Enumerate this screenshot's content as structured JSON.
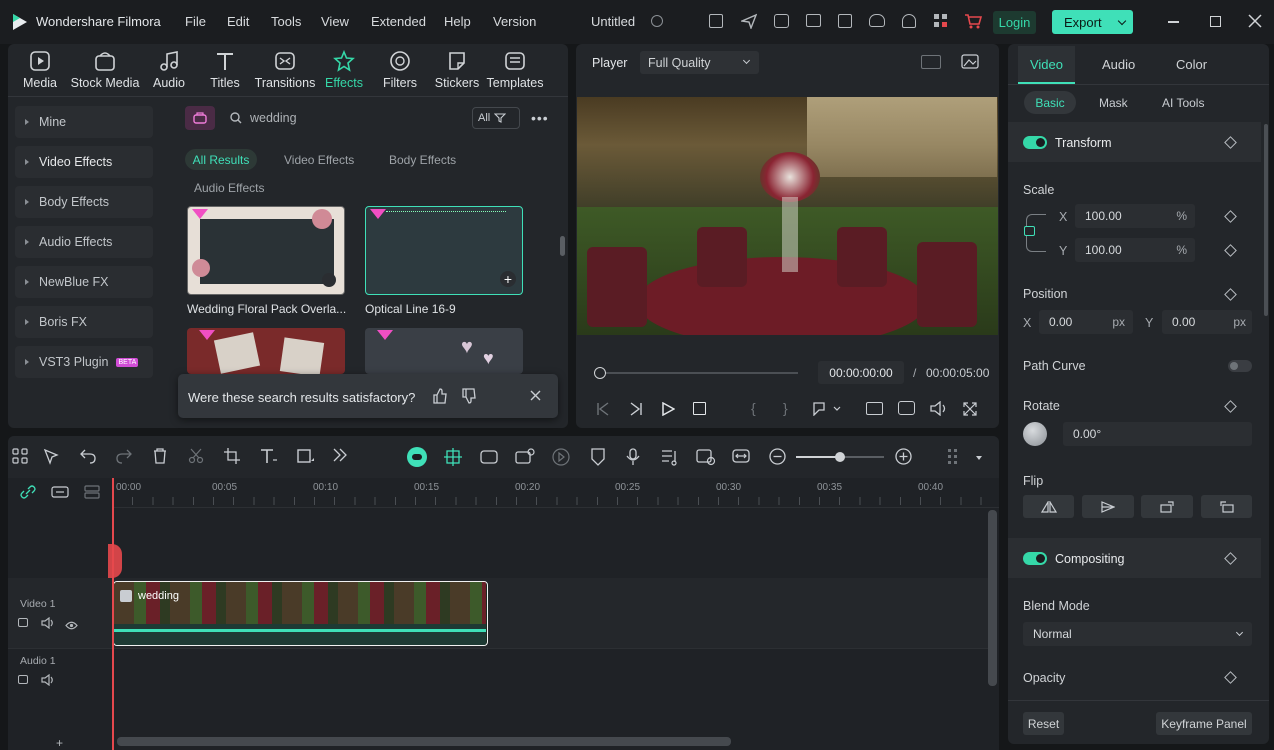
{
  "app": {
    "name": "Wondershare Filmora",
    "project_title": "Untitled"
  },
  "menu": [
    "File",
    "Edit",
    "Tools",
    "View",
    "Extended",
    "Help",
    "Version"
  ],
  "header_buttons": {
    "login": "Login",
    "export": "Export"
  },
  "toolbar": [
    {
      "label": "Media",
      "icon": "media-icon"
    },
    {
      "label": "Stock Media",
      "icon": "stock-media-icon"
    },
    {
      "label": "Audio",
      "icon": "audio-icon"
    },
    {
      "label": "Titles",
      "icon": "titles-icon"
    },
    {
      "label": "Transitions",
      "icon": "transitions-icon"
    },
    {
      "label": "Effects",
      "icon": "effects-icon"
    },
    {
      "label": "Filters",
      "icon": "filters-icon"
    },
    {
      "label": "Stickers",
      "icon": "stickers-icon"
    },
    {
      "label": "Templates",
      "icon": "templates-icon"
    }
  ],
  "categories": [
    "Mine",
    "Video Effects",
    "Body Effects",
    "Audio Effects",
    "NewBlue FX",
    "Boris FX",
    "VST3 Plugin"
  ],
  "beta_badge": "BETA",
  "search": {
    "value": "wedding",
    "filter": "All"
  },
  "result_tabs": [
    "All Results",
    "Video Effects",
    "Body Effects",
    "Audio Effects"
  ],
  "results": [
    {
      "name": "Wedding Floral Pack Overla..."
    },
    {
      "name": "Optical Line 16-9"
    }
  ],
  "feedback": {
    "question": "Were these search results satisfactory?"
  },
  "player": {
    "label": "Player",
    "quality": "Full Quality",
    "current_time": "00:00:00:00",
    "separator": "/",
    "total_time": "00:00:05:00"
  },
  "inspector": {
    "tabs": [
      "Video",
      "Audio",
      "Color"
    ],
    "subtabs": [
      "Basic",
      "Mask",
      "AI Tools"
    ],
    "transform": "Transform",
    "scale": {
      "label": "Scale",
      "x_label": "X",
      "x": "100.00",
      "y_label": "Y",
      "y": "100.00",
      "unit": "%"
    },
    "position": {
      "label": "Position",
      "x_label": "X",
      "x": "0.00",
      "y_label": "Y",
      "y": "0.00",
      "unit": "px"
    },
    "path_curve": "Path Curve",
    "rotate": {
      "label": "Rotate",
      "value": "0.00°"
    },
    "flip": "Flip",
    "compositing": "Compositing",
    "blend_mode": {
      "label": "Blend Mode",
      "value": "Normal"
    },
    "opacity": "Opacity",
    "reset": "Reset",
    "keyframe_panel": "Keyframe Panel"
  },
  "timeline": {
    "ruler": [
      "00:00",
      "00:05",
      "00:10",
      "00:15",
      "00:20",
      "00:25",
      "00:30",
      "00:35",
      "00:40"
    ],
    "tracks": [
      {
        "name": "Video 1"
      },
      {
        "name": "Audio 1"
      }
    ],
    "clip": {
      "name": "wedding"
    }
  },
  "colors": {
    "accent": "#35d8a8",
    "playhead": "#e5484d",
    "bg": "#151719",
    "panel": "#23262a"
  }
}
